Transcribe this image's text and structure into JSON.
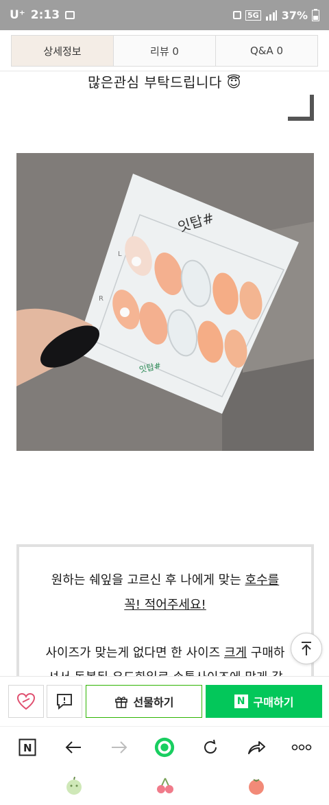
{
  "status_bar": {
    "carrier": "U⁺",
    "time": "2:13",
    "network": "5G",
    "battery": "37%"
  },
  "tabs": [
    {
      "label": "상세정보"
    },
    {
      "label": "리뷰  0"
    },
    {
      "label": "Q&A  0"
    }
  ],
  "notice": "많은관심 부탁드립니다 😇",
  "product": {
    "card_brand": "잇탑#",
    "card_brand_small": "잇탑#",
    "label_left": "L",
    "label_right": "R"
  },
  "info": {
    "line1_pre": "원하는 쉐잎을 고르신 후 나에게 맞는 ",
    "line1_u": "호수를",
    "line2_u": "꼭! 적어주세요!",
    "line3_pre": "사이즈가 맞는게 없다면 한 사이즈 ",
    "line3_u": "크게",
    "line3_post": " 구매하",
    "line4": "셔서 동봉된 우드화일로 손톱사이즈에 맞게 갈"
  },
  "actions": {
    "gift_label": "선물하기",
    "buy_label": "구매하기"
  },
  "colors": {
    "accent_green": "#03c75a",
    "tab_active_bg": "#f4ede6",
    "status_bg": "#9e9e9e"
  },
  "icons": {
    "like": "heart-icon",
    "talk": "chat-icon",
    "gift": "gift-icon",
    "naver": "naver-n-icon",
    "scroll_top": "arrow-up-icon",
    "browser": [
      "naver-n-icon",
      "back-arrow-icon",
      "forward-arrow-icon",
      "home-circle-icon",
      "refresh-icon",
      "share-icon",
      "more-icon"
    ],
    "nav": [
      "apple-icon",
      "cherry-icon",
      "tomato-icon"
    ]
  }
}
